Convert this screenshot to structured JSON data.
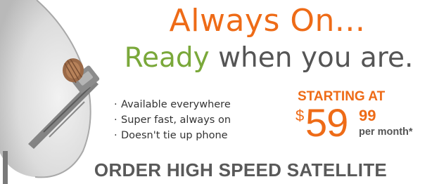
{
  "ad": {
    "headline": "Always On...",
    "subheadline_highlight": "Ready",
    "subheadline_rest": " when you are.",
    "bullet_marker": "·",
    "bullets": [
      "Available everywhere",
      "Super fast, always on",
      "Doesn't tie up phone"
    ],
    "price": {
      "label": "STARTING AT",
      "currency": "$",
      "dollars": "59",
      "cents": "99",
      "period": "per month*"
    },
    "cta": "ORDER HIGH SPEED SATELLITE"
  },
  "colors": {
    "accent_orange": "#ee6b17",
    "accent_green": "#7aa83a",
    "text_gray": "#555555",
    "cta_gray": "#595959"
  },
  "icons": {
    "dish": "satellite-dish-icon"
  }
}
